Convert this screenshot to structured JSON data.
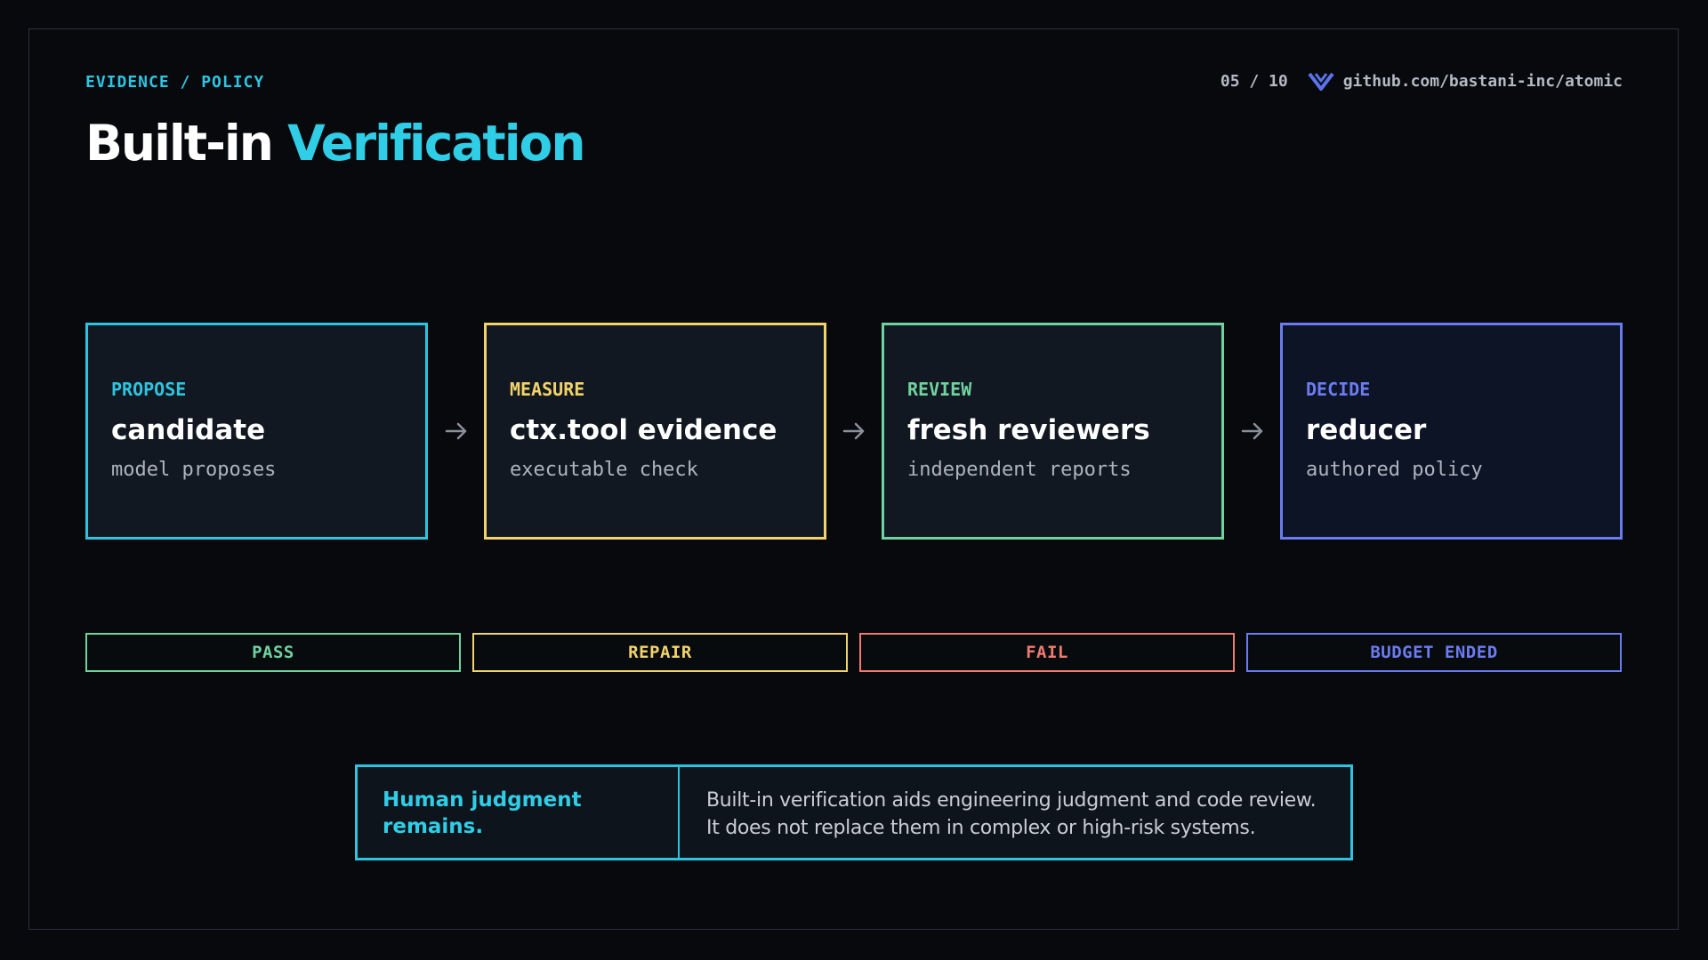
{
  "header": {
    "section_label": "EVIDENCE / POLICY",
    "page_indicator": "05 / 10",
    "repo_link": "github.com/bastani-inc/atomic",
    "logo_icon": "atomic-logo-icon"
  },
  "title": {
    "part1": "Built-in",
    "part2": "Verification"
  },
  "pipeline": {
    "stages": [
      {
        "kicker": "PROPOSE",
        "heading": "candidate",
        "sub": "model proposes",
        "color": "#2dc4e0"
      },
      {
        "kicker": "MEASURE",
        "heading": "ctx.tool evidence",
        "sub": "executable check",
        "color": "#f2d36b"
      },
      {
        "kicker": "REVIEW",
        "heading": "fresh reviewers",
        "sub": "independent reports",
        "color": "#6fd3a0"
      },
      {
        "kicker": "DECIDE",
        "heading": "reducer",
        "sub": "authored policy",
        "color": "#6b7cf2"
      }
    ],
    "arrow_icon": "arrow-right-icon"
  },
  "outcomes": [
    {
      "label": "PASS",
      "color": "#6fd3a0"
    },
    {
      "label": "REPAIR",
      "color": "#f2d36b"
    },
    {
      "label": "FAIL",
      "color": "#f07a70"
    },
    {
      "label": "BUDGET ENDED",
      "color": "#6b7cf2"
    }
  ],
  "note": {
    "title_line1": "Human judgment",
    "title_line2": "remains.",
    "body_line1": "Built-in verification aids engineering judgment and code review.",
    "body_line2": "It does not replace them in complex or high-risk systems."
  }
}
